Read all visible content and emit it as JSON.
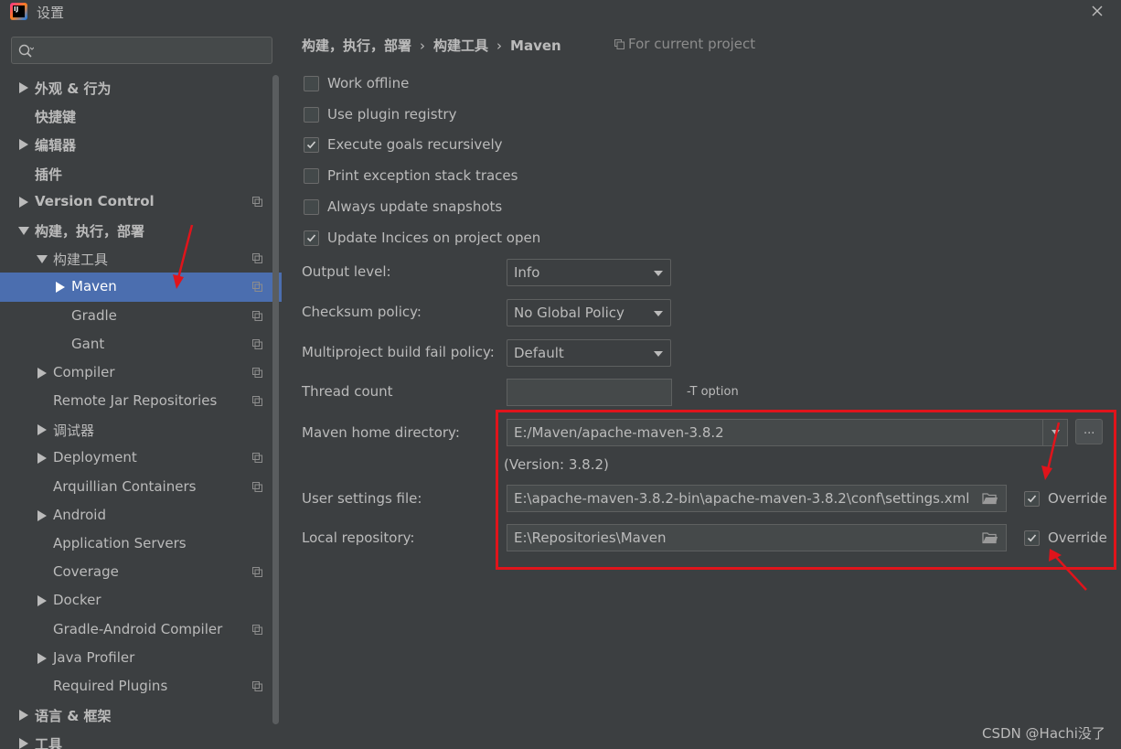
{
  "window": {
    "title": "设置",
    "logo_text": "IJ"
  },
  "sidebar": {
    "search_placeholder": "",
    "items": [
      {
        "label": "外观 & 行为",
        "arrow": "right",
        "indent": 0,
        "bold": true,
        "proj": false
      },
      {
        "label": "快捷键",
        "arrow": "none",
        "indent": 0,
        "bold": true,
        "proj": false
      },
      {
        "label": "编辑器",
        "arrow": "right",
        "indent": 0,
        "bold": true,
        "proj": false
      },
      {
        "label": "插件",
        "arrow": "none",
        "indent": 0,
        "bold": true,
        "proj": false
      },
      {
        "label": "Version Control",
        "arrow": "right",
        "indent": 0,
        "bold": true,
        "proj": true
      },
      {
        "label": "构建，执行，部署",
        "arrow": "down",
        "indent": 0,
        "bold": true,
        "proj": false
      },
      {
        "label": "构建工具",
        "arrow": "down",
        "indent": 1,
        "bold": false,
        "proj": true
      },
      {
        "label": "Maven",
        "arrow": "right",
        "indent": 2,
        "bold": false,
        "proj": true,
        "selected": true
      },
      {
        "label": "Gradle",
        "arrow": "none",
        "indent": 2,
        "bold": false,
        "proj": true
      },
      {
        "label": "Gant",
        "arrow": "none",
        "indent": 2,
        "bold": false,
        "proj": true
      },
      {
        "label": "Compiler",
        "arrow": "right",
        "indent": 1,
        "bold": false,
        "proj": true
      },
      {
        "label": "Remote Jar Repositories",
        "arrow": "none",
        "indent": 1,
        "bold": false,
        "proj": true
      },
      {
        "label": "调试器",
        "arrow": "right",
        "indent": 1,
        "bold": false,
        "proj": false
      },
      {
        "label": "Deployment",
        "arrow": "right",
        "indent": 1,
        "bold": false,
        "proj": true
      },
      {
        "label": "Arquillian Containers",
        "arrow": "none",
        "indent": 1,
        "bold": false,
        "proj": true
      },
      {
        "label": "Android",
        "arrow": "right",
        "indent": 1,
        "bold": false,
        "proj": false
      },
      {
        "label": "Application Servers",
        "arrow": "none",
        "indent": 1,
        "bold": false,
        "proj": false
      },
      {
        "label": "Coverage",
        "arrow": "none",
        "indent": 1,
        "bold": false,
        "proj": true
      },
      {
        "label": "Docker",
        "arrow": "right",
        "indent": 1,
        "bold": false,
        "proj": false
      },
      {
        "label": "Gradle-Android Compiler",
        "arrow": "none",
        "indent": 1,
        "bold": false,
        "proj": true
      },
      {
        "label": "Java Profiler",
        "arrow": "right",
        "indent": 1,
        "bold": false,
        "proj": false
      },
      {
        "label": "Required Plugins",
        "arrow": "none",
        "indent": 1,
        "bold": false,
        "proj": true
      },
      {
        "label": "语言 & 框架",
        "arrow": "right",
        "indent": 0,
        "bold": true,
        "proj": false
      },
      {
        "label": "工具",
        "arrow": "right",
        "indent": 0,
        "bold": true,
        "proj": false
      }
    ]
  },
  "content": {
    "breadcrumb": [
      "构建，执行，部署",
      "构建工具",
      "Maven"
    ],
    "breadcrumb_sep": "›",
    "for_current_project": "For current project",
    "checkboxes": [
      {
        "label": "Work offline",
        "checked": false
      },
      {
        "label": "Use plugin registry",
        "checked": false
      },
      {
        "label": "Execute goals recursively",
        "checked": true
      },
      {
        "label": "Print exception stack traces",
        "checked": false
      },
      {
        "label": "Always update snapshots",
        "checked": false
      },
      {
        "label": "Update Incices on project open",
        "checked": true
      }
    ],
    "output_level": {
      "label": "Output level:",
      "value": "Info"
    },
    "checksum_policy": {
      "label": "Checksum policy:",
      "value": "No Global Policy"
    },
    "multiproject_fail_policy": {
      "label": "Multiproject build fail policy:",
      "value": "Default"
    },
    "thread_count": {
      "label": "Thread count",
      "value": "",
      "option_hint": "-T option"
    },
    "maven_home": {
      "label": "Maven home directory:",
      "value": "E:/Maven/apache-maven-3.8.2",
      "browse": "...",
      "version": "(Version: 3.8.2)"
    },
    "user_settings": {
      "label": "User settings file:",
      "value": "E:\\apache-maven-3.8.2-bin\\apache-maven-3.8.2\\conf\\settings.xml",
      "override_label": "Override",
      "override_checked": true
    },
    "local_repository": {
      "label": "Local repository:",
      "value": "E:\\Repositories\\Maven",
      "override_label": "Override",
      "override_checked": true
    }
  },
  "watermark": "CSDN @Hachi没了",
  "colors": {
    "background": "#3c3f41",
    "selection": "#4b6eaf",
    "text": "#bbbbbb",
    "annotation_red": "#e0141b"
  }
}
